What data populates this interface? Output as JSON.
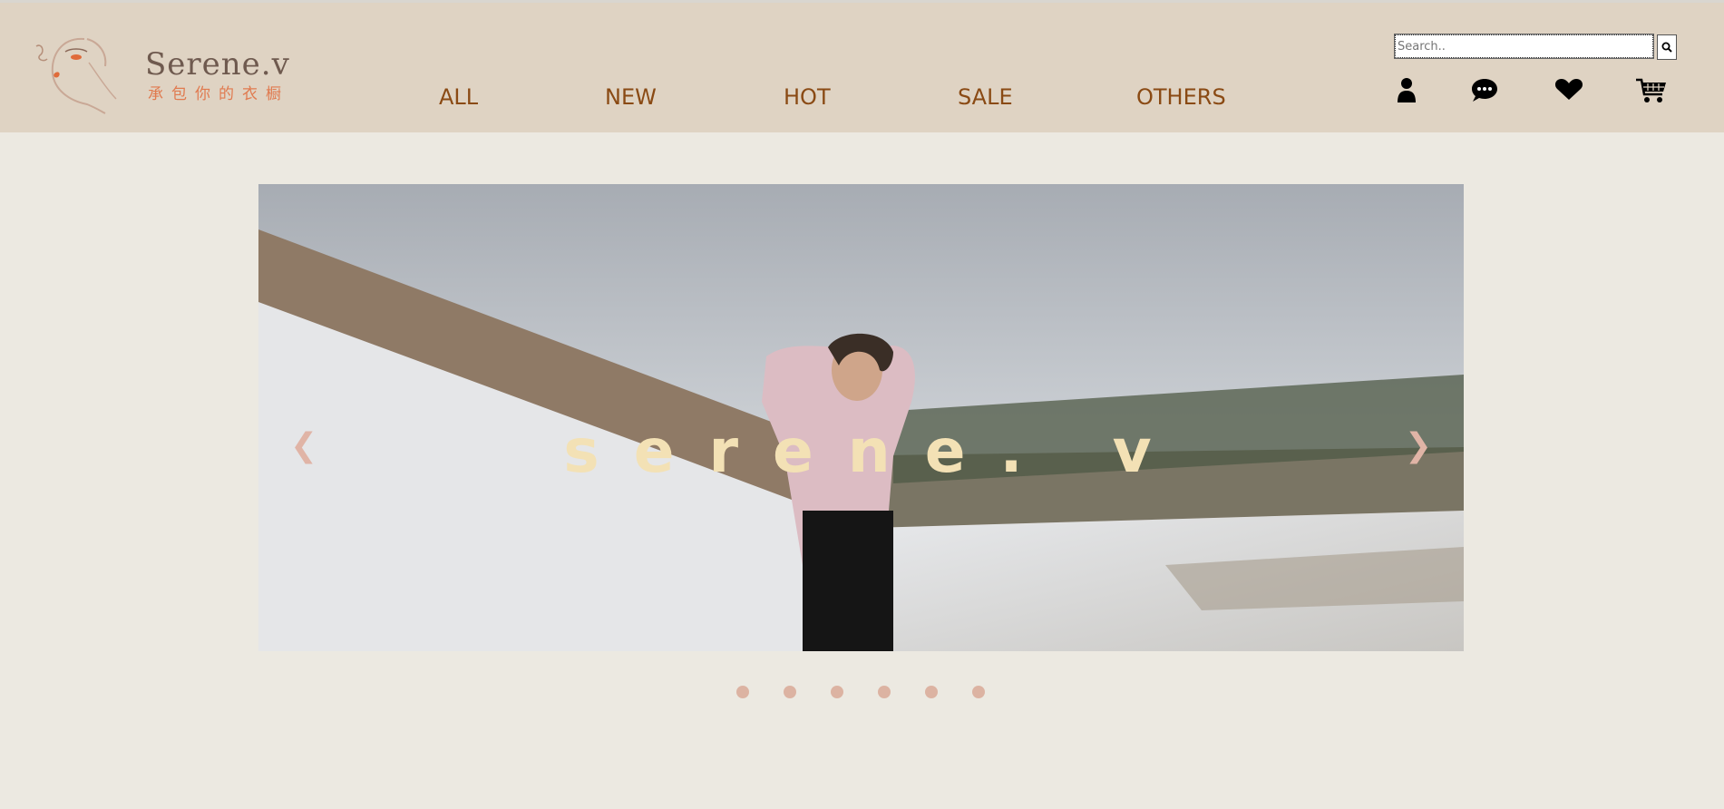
{
  "header": {
    "brand_name": "Serene.v",
    "brand_tagline": "承包你的衣橱",
    "nav": [
      "ALL",
      "NEW",
      "HOT",
      "SALE",
      "OTHERS"
    ],
    "search_placeholder": "Search.."
  },
  "icons": {
    "search": "search-icon",
    "user": "user-icon",
    "messages": "chat-icon",
    "wishlist": "heart-icon",
    "cart": "cart-icon"
  },
  "slider": {
    "caption": "serene. v",
    "prev": "❮",
    "next": "❯",
    "dot_count": 6
  },
  "colors": {
    "header_bg": "#dfd3c3",
    "page_bg": "#ece9e1",
    "nav_text": "#8a4a14",
    "dot": "#dcb3a2"
  }
}
